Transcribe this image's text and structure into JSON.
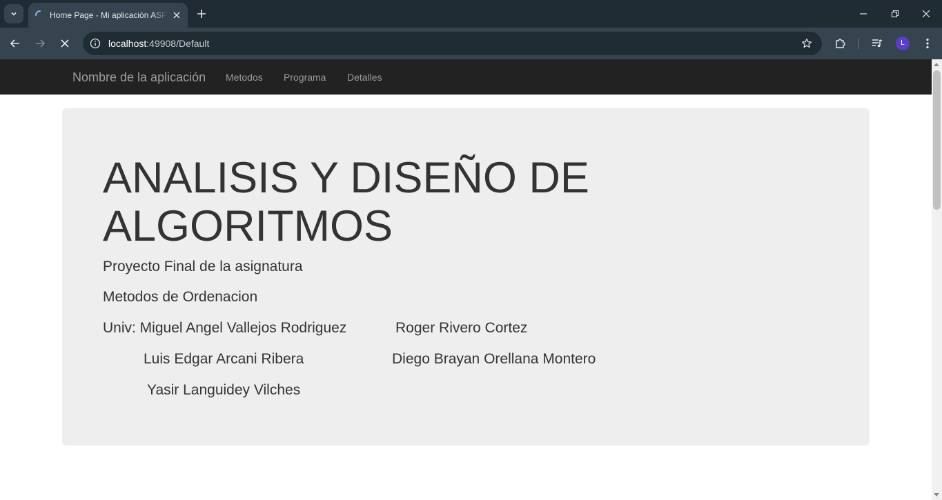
{
  "browser": {
    "tab_title": "Home Page - Mi aplicación ASP.NET",
    "url_host": "localhost",
    "url_rest": ":49908/Default",
    "profile_initial": "L"
  },
  "navbar": {
    "brand": "Nombre de la aplicación",
    "links": [
      "Metodos",
      "Programa",
      "Detalles"
    ]
  },
  "jumbotron": {
    "title": "ANALISIS Y DISEÑO DE ALGORITMOS",
    "subtitle": "Proyecto Final de la asignatura",
    "topic": "Metodos de Ordenacion",
    "authors_prefix": "Univ: Miguel Angel Vallejos Rodriguez",
    "authors": [
      "Roger Rivero Cortez",
      "Luis Edgar Arcani Ribera",
      "Diego Brayan Orellana Montero",
      "Yasir Languidey Vilches"
    ]
  }
}
